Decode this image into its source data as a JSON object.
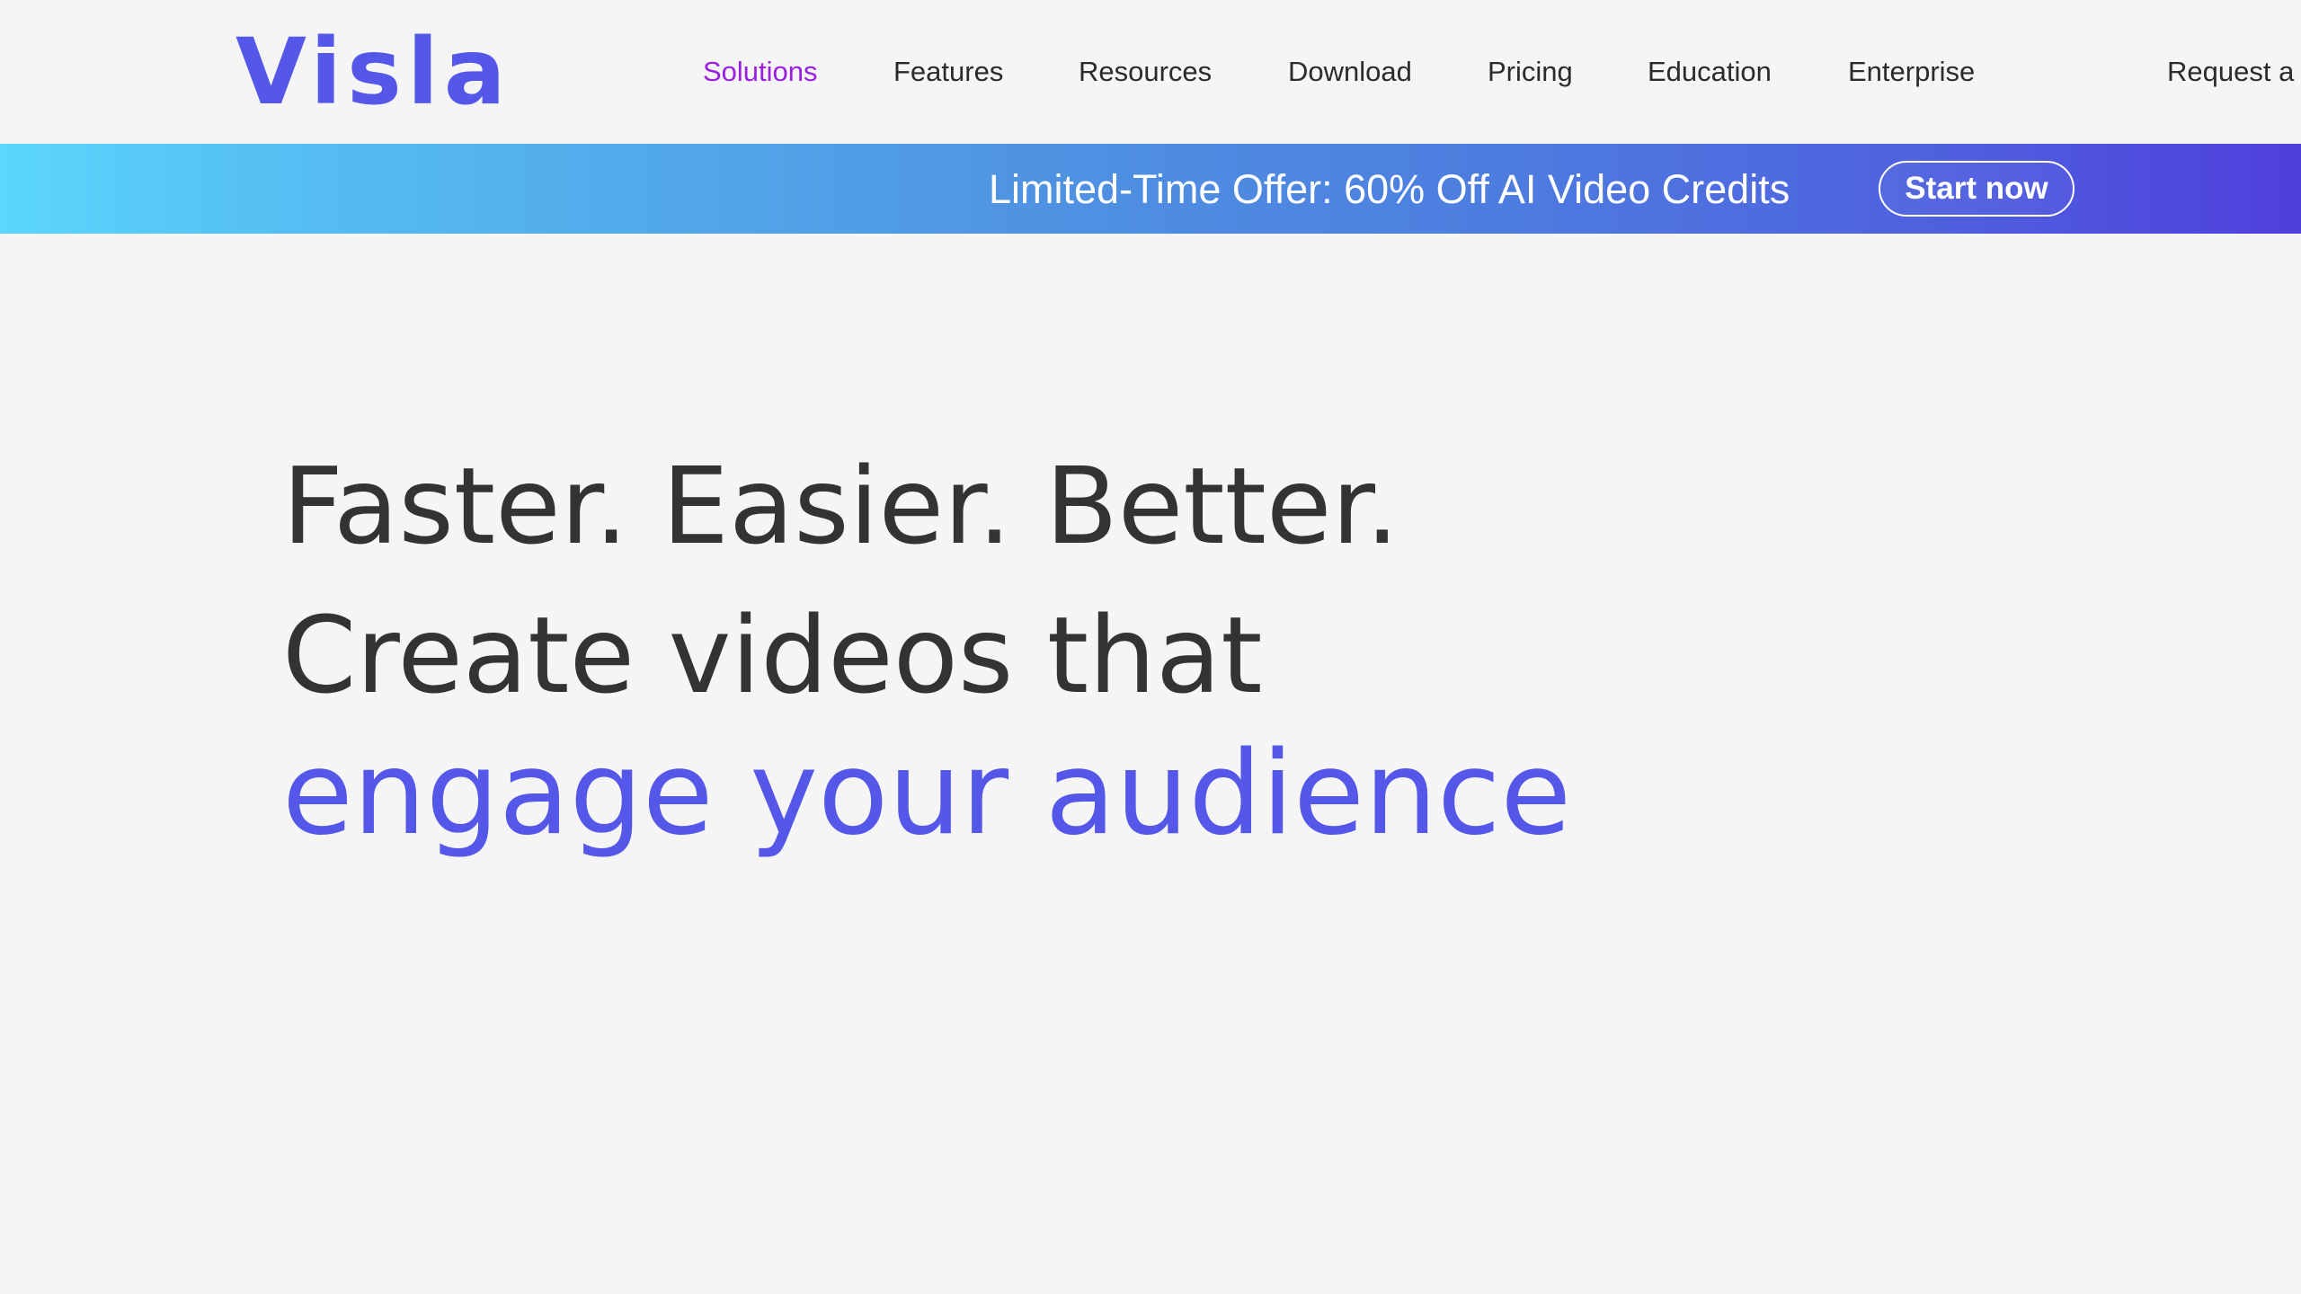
{
  "brand": {
    "logo_text": "Visla",
    "accent_color": "#5457e8",
    "active_nav_color": "#9b1fe0"
  },
  "nav": {
    "items": [
      {
        "label": "Solutions",
        "active": true
      },
      {
        "label": "Features",
        "active": false
      },
      {
        "label": "Resources",
        "active": false
      },
      {
        "label": "Download",
        "active": false
      },
      {
        "label": "Pricing",
        "active": false
      },
      {
        "label": "Education",
        "active": false
      },
      {
        "label": "Enterprise",
        "active": false
      },
      {
        "label": "Request a",
        "active": false
      }
    ]
  },
  "banner": {
    "text": "Limited-Time Offer: 60% Off AI Video Credits",
    "button_label": "Start now"
  },
  "hero": {
    "line1": "Faster. Easier. Better.",
    "line2": "Create videos that",
    "line3": "engage your audience"
  }
}
